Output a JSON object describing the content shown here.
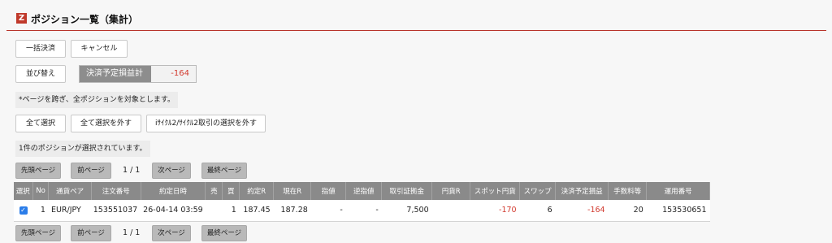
{
  "header": {
    "logo": "Z",
    "title": "ポジション一覧（集計）"
  },
  "actions": {
    "bulk_settle": "一括決済",
    "cancel": "キャンセル",
    "sort": "並び替え"
  },
  "pl_summary": {
    "label": "決済予定損益計",
    "value": "-164"
  },
  "notes": {
    "cross_page": "*ページを跨ぎ、全ポジションを対象とします。",
    "selected_count": "1件のポジションが選択されています。"
  },
  "selection": {
    "select_all": "全て選択",
    "deselect_all": "全て選択を外す",
    "deselect_cycle": "iｻｲｸﾙ2/ｻｲｸﾙ2取引の選択を外す"
  },
  "pagination": {
    "first": "先頭ページ",
    "prev": "前ページ",
    "info": "1 / 1",
    "next": "次ページ",
    "last": "最終ページ"
  },
  "table": {
    "headers": [
      "選択",
      "No",
      "通貨ペア",
      "注文番号",
      "約定日時",
      "売",
      "買",
      "約定R",
      "現在R",
      "指値",
      "逆指値",
      "取引証拠金",
      "円貨R",
      "スポット円貨",
      "スワップ",
      "決済予定損益",
      "手数料等",
      "運用番号"
    ],
    "rows": [
      {
        "selected": true,
        "no": "1",
        "pair": "EUR/JPY",
        "order": "153551037",
        "datetime": "26-04-14 03:59",
        "sell": "",
        "buy": "1",
        "exec_rate": "187.45",
        "current_rate": "187.28",
        "limit": "-",
        "stop": "-",
        "margin": "7,500",
        "yen_rate": "",
        "spot_yen": "-170",
        "swap": "6",
        "pl": "-164",
        "fee": "20",
        "ops_no": "153530651"
      }
    ]
  },
  "colors": {
    "accent": "#b8342b",
    "negative": "#d23a2f",
    "header_bg": "#8a8a8a",
    "checkbox": "#2b7de9"
  }
}
